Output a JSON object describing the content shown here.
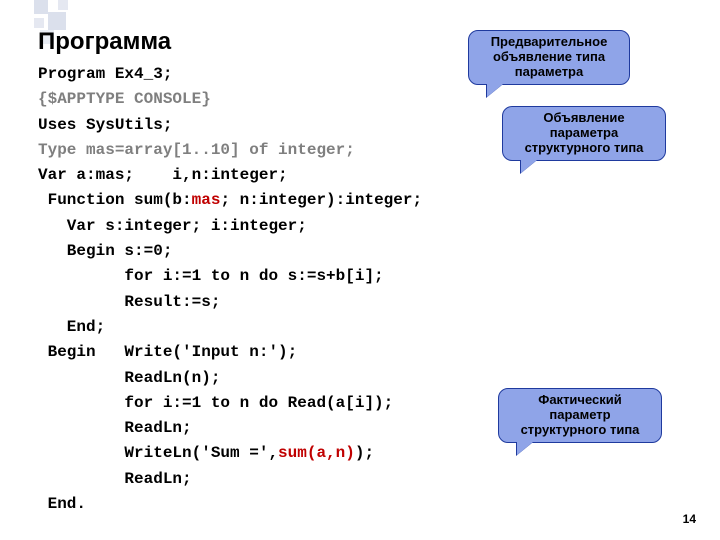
{
  "title": "Программа",
  "page_number": "14",
  "code": {
    "l1a": "Program Ex4_3;",
    "l2a": "{$APPTYPE CONSOLE}",
    "l3a": "Uses SysUtils;",
    "l4a": "Type mas=array[1..10] of integer;",
    "l5a": "Var a:mas;    i,n:integer;",
    "l6a": " Function sum(b:",
    "l6b": "mas",
    "l6c": "; n:integer):integer;",
    "l7a": "   Var s:integer; i:integer;",
    "l8a": "   Begin s:=0;",
    "l9a": "         for i:=1 to n do s:=s+b[i];",
    "l10a": "         Result:=s;",
    "l11a": "   End;",
    "l12a": " Begin   Write('Input n:');",
    "l13a": "         ReadLn(n);",
    "l14a": "         for i:=1 to n do Read(a[i]);",
    "l15a": "         ReadLn;",
    "l16a": "         WriteLn('Sum =',",
    "l16b": "sum(a,n)",
    "l16c": ");",
    "l17a": "         ReadLn;",
    "l18a": " End."
  },
  "callouts": {
    "c1": "Предварительное\nобъявление типа\nпараметра",
    "c2": "Объявление\nпараметра\nструктурного типа",
    "c3": "Фактический\nпараметр\nструктурного типа"
  }
}
